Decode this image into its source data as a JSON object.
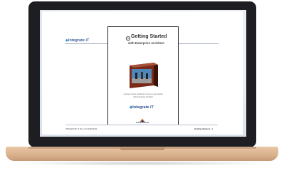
{
  "document": {
    "side_brand": "Integrate iT",
    "cover": {
      "title": "Getting Started",
      "subtitle": "with Enterprise Architect",
      "description_line1": "A series of best practices to help you get started",
      "description_line2": "with Enterprise Architect",
      "brand": "Integrate iT"
    },
    "footer": {
      "left": "INTEGRATE IT Pty Ltd (2018/2019)",
      "right": "Getting Started · 1",
      "badge": "SPARX SYSTEMS"
    }
  },
  "colors": {
    "brand_blue": "#2f4f8f",
    "accent_blue": "#3c8fd6",
    "laptop_base": "#d9b08c",
    "bezel": "#1e1e22"
  },
  "icons": {
    "cover_logo": "gear-icon",
    "footer_badge": "sparx-logo-icon"
  }
}
